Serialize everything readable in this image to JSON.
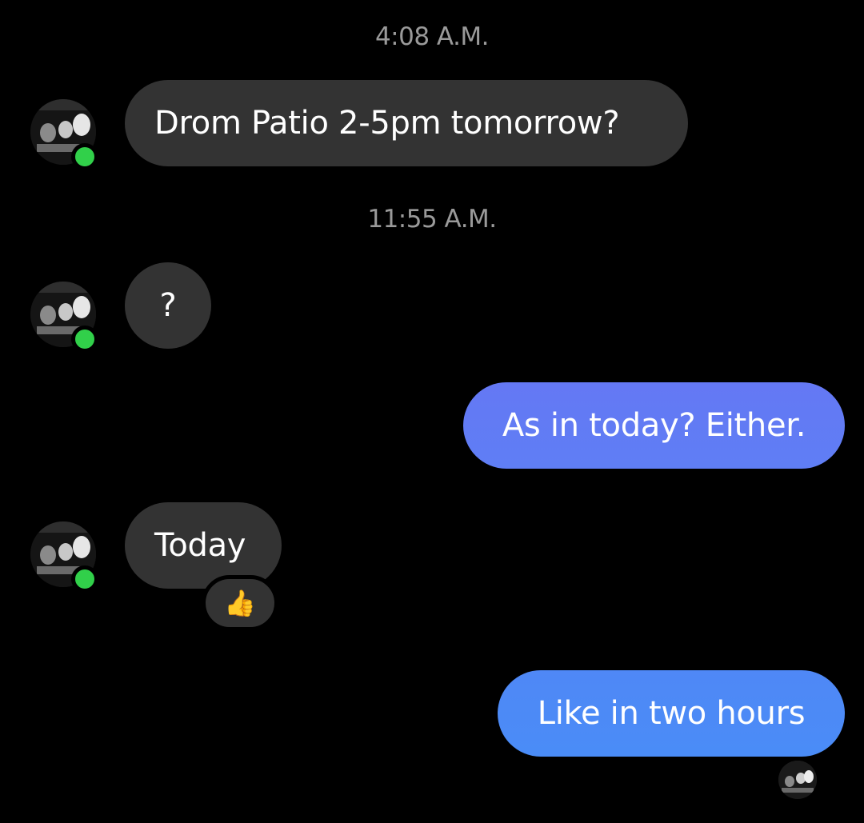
{
  "thread": {
    "timestamps": [
      "4:08 A.M.",
      "11:55 A.M."
    ],
    "messages": [
      {
        "from": "contact",
        "text": "Drom Patio 2-5pm tomorrow?"
      },
      {
        "from": "contact",
        "text": "?"
      },
      {
        "from": "me",
        "text": "As in today? Either."
      },
      {
        "from": "contact",
        "text": "Today",
        "reaction": "👍"
      },
      {
        "from": "me",
        "text": "Like in two hours"
      }
    ]
  },
  "colors": {
    "background": "#000000",
    "incoming_bubble": "#333333",
    "outgoing_bubble_top": "#6478f4",
    "outgoing_bubble_bottom": "#4a8cf7",
    "online_indicator": "#31d04a",
    "timestamp_text": "#9a9a9a"
  },
  "icons": {
    "contact_avatar": "contact-avatar-photo",
    "online_status": "online-dot-icon",
    "reaction": "thumbs-up-icon",
    "read_receipt": "seen-avatar-icon"
  }
}
